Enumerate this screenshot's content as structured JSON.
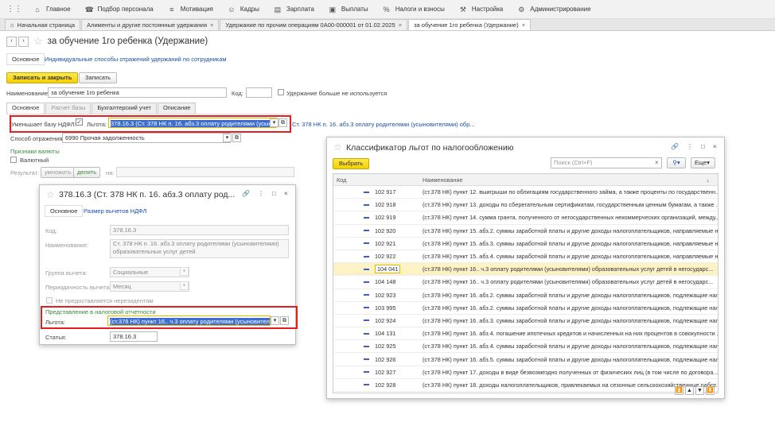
{
  "menu": [
    {
      "icon": "home-icon",
      "glyph": "⌂",
      "label": "Главное"
    },
    {
      "icon": "phone-icon",
      "glyph": "☎",
      "label": "Подбор персонала"
    },
    {
      "icon": "list-icon",
      "glyph": "≡",
      "label": "Мотивация"
    },
    {
      "icon": "people-icon",
      "glyph": "☺",
      "label": "Кадры"
    },
    {
      "icon": "calculator-icon",
      "glyph": "▤",
      "label": "Зарплата"
    },
    {
      "icon": "payments-icon",
      "glyph": "▣",
      "label": "Выплаты"
    },
    {
      "icon": "percent-icon",
      "glyph": "%",
      "label": "Налоги и взносы"
    },
    {
      "icon": "wrench-icon",
      "glyph": "⚒",
      "label": "Настройка"
    },
    {
      "icon": "admin-icon",
      "glyph": "⚙",
      "label": "Администрирование"
    }
  ],
  "tabs": [
    {
      "label": "Начальная страница"
    },
    {
      "label": "Алименты и другие постоянные удержания"
    },
    {
      "label": "Удержание по прочим операциям 0А00-000001 от 01.02.2025"
    },
    {
      "label": "за обучение 1го ребенка (Удержание)"
    }
  ],
  "form": {
    "title": "за обучение 1го ребенка (Удержание)",
    "nav_main": "Основное",
    "nav_link": "Индивидуальные способы отражений удержаний по сотрудникам",
    "save_close": "Записать и закрыть",
    "save": "Записать",
    "name_label": "Наименование:",
    "name_value": "за обучение 1го ребенка",
    "code_label": "Код:",
    "code_value": "",
    "unused_label": "Удержание больше не используется",
    "subtabs": [
      "Основное",
      "Расчет базы",
      "Бухгалтерский учет",
      "Описание"
    ],
    "reduce_label": "Уменьшает базу НДФЛ:",
    "check_mark": "✓",
    "benefit_label": "Льгота:",
    "benefit_value": "378.16.3 (Ст. 378 НК п. 16. абз.3 оплату родителями (усыновителями) обр",
    "benefit_desc": "Ст. 378 НК п. 16. абз.3 оплату родителями (усыновителями) обр...",
    "method_label": "Способ отражения:",
    "method_value": "6990 Прочая задолженность",
    "currency_section": "Признаки валюты",
    "currency_label": "Валютный",
    "result_label": "Результат:",
    "multiply": "умножить",
    "divide": "делить",
    "on_label": "на:"
  },
  "deduction_window": {
    "title": "378.16.3 (Ст. 378 НК п. 16. абз.3 оплату род...",
    "nav_main": "Основное",
    "nav_link": "Размер вычетов НДФЛ",
    "code_label": "Код:",
    "code_value": "378.16.3",
    "name_label": "Наименование:",
    "name_value": "Ст. 378 НК п. 16. абз.3 оплату родителями (усыновителями) образовательных услуг детей",
    "group_label": "Группа вычета:",
    "group_value": "Социальные",
    "period_label": "Периодичность вычета:",
    "period_value": "Месяц",
    "nonres_label": "Не предоставляется нерезидентам",
    "report_section": "Представление в налоговой отчетности",
    "benefit_label": "Льгота:",
    "benefit_value": "(ст.378 НК) пункт 16.. ч.3 оплату родителями (усыновителями) обр",
    "article_label": "Статья:",
    "article_value": "378.16.3"
  },
  "classifier_window": {
    "title": "Классификатор льгот по налогообложению",
    "select_btn": "Выбрать",
    "search_placeholder": "Поиск (Ctrl+F)",
    "more_btn": "Еще",
    "col_code": "Код",
    "col_name": "Наименование",
    "rows": [
      {
        "code": "102 917",
        "name": "(ст.378 НК) пункт 12. выигрыши по облигациям государственного займа, а также проценты по государственн..."
      },
      {
        "code": "102 918",
        "name": "(ст.378 НК) пункт 13. доходы по сберегательным сертификатам, государственным ценным бумагам, а также ..."
      },
      {
        "code": "102 919",
        "name": "(ст.378 НК) пункт 14. сумма гранта, полученного от негосударственных некоммерческих организаций, между..."
      },
      {
        "code": "102 920",
        "name": "(ст.378 НК) пункт 15. абз.2. суммы заработной платы и другие доходы налогоплательщиков, направляемые не..."
      },
      {
        "code": "102 921",
        "name": "(ст.378 НК) пункт 15. абз.3. суммы заработной платы и другие доходы налогоплательщиков, направляемые н..."
      },
      {
        "code": "102 922",
        "name": "(ст.378 НК) пункт 15. абз.4. суммы заработной платы и другие доходы налогоплательщиков, направляемые н..."
      },
      {
        "code": "104 041",
        "name": "(ст.378 НК) пункт 16..  ч.3  оплату родителями (усыновителями) образовательных услуг детей в негосударс..."
      },
      {
        "code": "104 148",
        "name": "(ст.378 НК) пункт 16..  ч.3  оплату родителями (усыновителями) образовательных услуг детей в негосударс..."
      },
      {
        "code": "102 923",
        "name": "(ст.378 НК) пункт 16. абз.2. суммы заработной платы и другие доходы налогоплательщиков, подлежащие нал..."
      },
      {
        "code": "103 995",
        "name": "(ст.378 НК) пункт 16. абз.2. суммы заработной платы и другие доходы налогоплательщиков, подлежащие нал..."
      },
      {
        "code": "102 924",
        "name": "(ст.378 НК) пункт 16. абз.3. суммы заработной платы и другие доходы налогоплательщиков, подлежащие нал..."
      },
      {
        "code": "104 131",
        "name": "(ст.378 НК) пункт 16. абз.4. погашение ипотечных кредитов и начисленных на них процентов в совокупности ..."
      },
      {
        "code": "102 925",
        "name": "(ст.378 НК) пункт 16. абз.4. суммы заработной платы и другие доходы налогоплательщиков, подлежащие нал..."
      },
      {
        "code": "102 926",
        "name": "(ст.378 НК) пункт 16. абз.5. суммы заработной платы и другие доходы налогоплательщиков, подлежащие нал..."
      },
      {
        "code": "102 927",
        "name": "(ст.378 НК) пункт 17. доходы в виде безвозмездно полученных от физических лиц (в том числе по договора..."
      },
      {
        "code": "102 928",
        "name": "(ст.378 НК) пункт 18. доходы налогоплательщиков, привлекаемых на сезонные сельскохозяйственные работ..."
      }
    ]
  }
}
